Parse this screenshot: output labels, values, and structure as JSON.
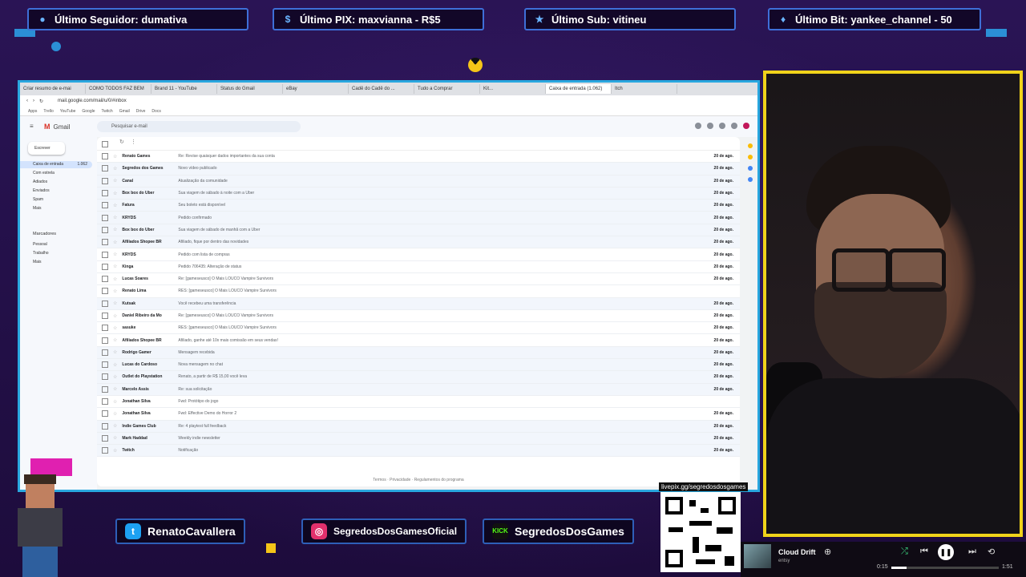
{
  "top_banners": [
    {
      "icon": "user-icon",
      "text": "Último Seguidor: dumativa"
    },
    {
      "icon": "pix-icon",
      "text": "Último PIX: maxvianna - R$5"
    },
    {
      "icon": "star-icon",
      "text": "Último Sub: vitineu"
    },
    {
      "icon": "diamond-icon",
      "text": "Último Bit: yankee_channel - 50"
    }
  ],
  "browser": {
    "tabs": [
      "Criar resumo de e-mai",
      "COMO TODOS FAZ BEM",
      "Brand 11 - YouTube",
      "Status do Gmail",
      "eBay",
      "Cadê do Cadê do ...",
      "Tudo a Comprar",
      "Kit...",
      "Caixa de entrada (1.062)",
      "Itch"
    ],
    "url": "mail.google.com/mail/u/0/#inbox",
    "bookmarks": [
      "Apps",
      "Trello",
      "YouTube",
      "Google",
      "Twitch",
      "Gmail",
      "Drive",
      "Docs"
    ]
  },
  "gmail": {
    "product": "Gmail",
    "search_placeholder": "Pesquisar e-mail",
    "compose_label": "Escrever",
    "nav": [
      {
        "label": "Caixa de entrada",
        "count": "1.062",
        "selected": true
      },
      {
        "label": "Com estrela",
        "count": ""
      },
      {
        "label": "Adiados",
        "count": ""
      },
      {
        "label": "Enviados",
        "count": ""
      },
      {
        "label": "Spam",
        "count": ""
      },
      {
        "label": "Mais",
        "count": ""
      }
    ],
    "labels_header": "Marcadores",
    "labels": [
      "Pessoal",
      "Trabalho",
      "Mais"
    ],
    "emails": [
      {
        "from": "Renato Games",
        "subject": "Re: Revise quaisquer dados importantes da sua conta",
        "date": "20 de ago.",
        "read": false
      },
      {
        "from": "Segredos dos Games",
        "subject": "Novo vídeo publicado",
        "date": "20 de ago.",
        "read": true
      },
      {
        "from": "Canal",
        "subject": "Atualização da comunidade",
        "date": "20 de ago.",
        "read": true
      },
      {
        "from": "Box box do Uber",
        "subject": "Sua viagem de sábado à noite com a Uber",
        "date": "20 de ago.",
        "read": true
      },
      {
        "from": "Fatura",
        "subject": "Seu boleto está disponível",
        "date": "20 de ago.",
        "read": true
      },
      {
        "from": "KRYDS",
        "subject": "Pedido confirmado",
        "date": "20 de ago.",
        "read": true
      },
      {
        "from": "Box box do Uber",
        "subject": "Sua viagem de sábado de manhã com a Uber",
        "date": "20 de ago.",
        "read": true
      },
      {
        "from": "Afiliados Shopee BR",
        "subject": "Afiliado, fique por dentro das novidades",
        "date": "20 de ago.",
        "read": true
      },
      {
        "from": "KRYDS",
        "subject": "Pedido com lista de compras",
        "date": "20 de ago.",
        "read": false
      },
      {
        "from": "Kinga",
        "subject": "Pedido 706435: Alteração de status",
        "date": "20 de ago.",
        "read": false
      },
      {
        "from": "Lucas Soares",
        "subject": "Re: [gameseusco] O Mais LOUCO Vampire Survivors",
        "date": "20 de ago.",
        "read": false
      },
      {
        "from": "Renato Lima",
        "subject": "RES: [gameseusco] O Mais LOUCO Vampire Survivors",
        "date": "",
        "read": false
      },
      {
        "from": "Kutsak",
        "subject": "Você recebeu uma transferência",
        "date": "20 de ago.",
        "read": true
      },
      {
        "from": "Daniel Ribeiro da Mo",
        "subject": "Re: [gameseusco] O Mais LOUCO Vampire Survivors",
        "date": "20 de ago.",
        "read": false
      },
      {
        "from": "sasuke",
        "subject": "RES: [gameseusco] O Mais LOUCO Vampire Survivors",
        "date": "20 de ago.",
        "read": false
      },
      {
        "from": "Afiliados Shopee BR",
        "subject": "Afiliado, ganhe até 10x mais comissão em seus vendas!",
        "date": "20 de ago.",
        "read": false
      },
      {
        "from": "Rodrigo Gamer",
        "subject": "Mensagem recebida",
        "date": "20 de ago.",
        "read": true
      },
      {
        "from": "Lucas do Cardoso",
        "subject": "Nova mensagem no chat",
        "date": "20 de ago.",
        "read": true
      },
      {
        "from": "Outlet do Playstation",
        "subject": "Renato, a partir de R$ 15,00 você leva",
        "date": "20 de ago.",
        "read": true
      },
      {
        "from": "Marcelo Assis",
        "subject": "Re: sua solicitação",
        "date": "20 de ago.",
        "read": true
      },
      {
        "from": "Jonathan Silva",
        "subject": "Fwd: Protótipo do jogo",
        "date": "",
        "read": false
      },
      {
        "from": "Jonathan Silva",
        "subject": "Fwd: Effective Demo do Horror 2",
        "date": "20 de ago.",
        "read": false
      },
      {
        "from": "Indie Games Club",
        "subject": "Re: 4 playtest full feedback",
        "date": "20 de ago.",
        "read": true
      },
      {
        "from": "Mark Haddad",
        "subject": "Weekly indie newsletter",
        "date": "20 de ago.",
        "read": true
      },
      {
        "from": "Twitch",
        "subject": "Notificação",
        "date": "20 de ago.",
        "read": true
      }
    ],
    "footer": "Termos · Privacidade · Regulamentos do programa"
  },
  "socials": [
    {
      "icon": "twitter-icon",
      "text": "RenatoCavallera",
      "color": "#1da1f2"
    },
    {
      "icon": "instagram-icon",
      "text": "SegredosDosGamesOficial",
      "color": "#e1306c"
    },
    {
      "icon": "kick-icon",
      "text": "SegredosDosGames",
      "color": "#53fc18"
    }
  ],
  "qr_caption": "livepix.gg/segredosdosgames",
  "player": {
    "title": "Cloud Drift",
    "artist": "entsy",
    "elapsed": "0:15",
    "total": "1:51",
    "progress": 0.14
  },
  "colors": {
    "accent_border": "#29a7df",
    "cam_border": "#f0d31a",
    "banner_border": "#3e6fd8"
  }
}
